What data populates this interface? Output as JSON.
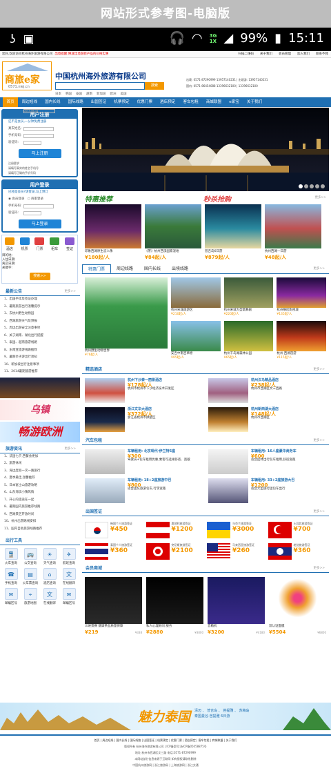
{
  "banner": {
    "title": "网站形式参考图-电脑版"
  },
  "status": {
    "network": "3G\n1X",
    "battery": "99%",
    "time": "15:11"
  },
  "colors": {
    "brand": "#1f6fb2",
    "accent": "#f39800",
    "price": "#f39800"
  },
  "topbar": {
    "welcome": "您好,欢迎访问杭州海外旅游有限公司",
    "notice": "出境提醒:释放出境游新产品的价格实惠",
    "links": [
      "扫描二维码",
      "关于我们",
      "会员管理",
      "加入我们",
      "联系不我"
    ]
  },
  "header": {
    "logo_text": "商旅e家",
    "logo_url": "0571.nlej.cn",
    "company": "中国杭州海外旅游有限公司",
    "search_btn": "搜索",
    "hot_keywords": [
      "日本",
      "韩国",
      "泰国",
      "越南",
      "新加坡",
      "欧洲",
      "美国"
    ],
    "contact_lines": [
      "出境: 0571-87290999  13957140231  | 出境游: 13957140231",
      "国内: 0571-86454088  13396632100  | 13396632100"
    ]
  },
  "nav": {
    "items": [
      "首页",
      "周边短线",
      "国内长线",
      "国际线路",
      "出国签证",
      "机票预定",
      "优惠门票",
      "酒店预定",
      "客车包租",
      "商城联盟",
      "e家宝",
      "关于我们"
    ]
  },
  "register": {
    "title": "用户注册",
    "note": "还不是会员,一分钟免费注册",
    "fields": [
      "真实姓名:",
      "手机号码:",
      "验证码:"
    ],
    "button": "马上注册",
    "tips": [
      "注册要求",
      "请填写真实的姓名手机号",
      "请填写正确的手机号码"
    ]
  },
  "login": {
    "title": "用户登录",
    "note": "已经是会员?请登录,马上预订",
    "options": [
      "会员登录",
      "商家登录"
    ],
    "fields": [
      "手机号码:",
      "验证码:"
    ],
    "button": "马上登录"
  },
  "booking": {
    "tabs": [
      "酒店",
      "机票",
      "门票",
      "租车",
      "签证"
    ],
    "fields": [
      "目的地:",
      "入住日期:",
      "离店日期:",
      "关键字:"
    ],
    "dates": [
      "2015-06-14",
      "2015-06-15"
    ],
    "button": "搜索>>"
  },
  "news": {
    "title": "最新公告",
    "more": "更多>>",
    "items": [
      "1、出国手续及签证办理",
      "2、暑期旅游出行温馨提示",
      "3、去杭州野生动物园",
      "4、西湖旅游天气及预报",
      "5、周边出游安全注意事项",
      "6、关于湖南、湖北出行提醒",
      "7、泰国、越南旅游线路",
      "8、东南亚旅游线路推荐",
      "9、暑期亲子游出行须知",
      "10、新加坡出行注意事项",
      "11、2014暑期旅游推荐"
    ]
  },
  "ads": {
    "wuzhen": "乌镇",
    "europe": "畅游欧洲"
  },
  "tips2": {
    "title": "旅游资讯",
    "more": "更多>>",
    "items": [
      "1、法国七夕,西餐会更加",
      "2、旅游休闲",
      "3、海边度假一次一路旅行",
      "4、夏季最佳,温馨推荐",
      "5、日本富士山旅游攻略",
      "6、山东海滨小镇风情",
      "7、开心的旅途在一起",
      "8、暑期国内旅游推荐线路",
      "9、西湖景区开放时间",
      "10、杭州出游路线安排",
      "11、国内自助旅游线路推荐"
    ]
  },
  "tools": {
    "title": "出行工具",
    "items": [
      "火车查询",
      "公交查询",
      "天气查询",
      "航班查询",
      "手机查询",
      "火车票查询",
      "酒店查询",
      "在线翻译",
      "邮编区号",
      "旅游地图",
      "在线翻译",
      "邮编区号"
    ]
  },
  "promo": {
    "special_title": "特惠推荐",
    "flash_title": "秒杀抢购",
    "more": "更多>>",
    "cards": [
      {
        "name": "印象西湖原生态人像",
        "price": "¥180起/人"
      },
      {
        "name": "《茶》杭州西溪国家湿地",
        "price": "¥84起/人"
      },
      {
        "name": "普吉岛6日游",
        "price": "¥879起/人"
      },
      {
        "name": "杭州西湖一日游",
        "price": "¥48起/人"
      }
    ]
  },
  "routes": {
    "tabs": [
      "特惠门票",
      "周边线路",
      "国内长线",
      "出境线路"
    ],
    "more": "更多>>",
    "items": [
      {
        "name": "杭州野生动物世界",
        "price": "¥76起/人"
      },
      {
        "name": "杭州宋城旅游区",
        "price": "¥210起/人"
      },
      {
        "name": "杭州宋城大型歌舞剧",
        "price": "¥220起/人"
      },
      {
        "name": "杭州横店影视城",
        "price": "¥135起/人"
      },
      {
        "name": "安吉中南百草原",
        "price": "¥95起/人"
      },
      {
        "name": "杭州千岛湖森林公园",
        "price": "¥65起/人"
      },
      {
        "name": "杭州 西湖夜游",
        "price": "¥115起/人"
      }
    ]
  },
  "hotels": {
    "title": "精选酒店",
    "more": "更多>>",
    "items": [
      {
        "name": "杭州下沙泰一丽景酒店",
        "price": "¥178起/人",
        "addr": "杭州市杭州市下沙经济技术开发区"
      },
      {
        "name": "杭州汉马精品酒店",
        "price": "¥238起/人",
        "addr": "杭州市西湖区文三西路"
      },
      {
        "name": "浙江文华大酒店",
        "price": "¥372起/人",
        "addr": "浙江省杭州市拱墅区"
      },
      {
        "name": "杭州新西湖大酒店",
        "price": "¥148起/人",
        "addr": "杭州市西湖区"
      }
    ]
  },
  "buses": {
    "title": "汽车包租",
    "more": "更多>>",
    "items": [
      {
        "name": "车辆租用: 北京现代·伊兰特5座",
        "price": "¥300",
        "desc": "驾驶员+包车租用优惠,乘客可选择舒适、宽敞"
      },
      {
        "name": "车辆租用: 16人座豪华商务车",
        "price": "¥600",
        "desc": "适合团体出行包车租用,舒适宽敞"
      },
      {
        "name": "车辆租用: 18+2座旅游中巴",
        "price": "¥800",
        "desc": "适合团队旅游包车,行李宽敞"
      },
      {
        "name": "车辆租用: 33+2座旅游大巴",
        "price": "¥1200",
        "desc": "适合大型旅行团包车出行"
      }
    ]
  },
  "visas": {
    "title": "出国签证",
    "more": "更多>>",
    "items": [
      {
        "name": "韩国个人旅游签证",
        "price": "¥450"
      },
      {
        "name": "奥地利旅游签证",
        "price": "¥1200"
      },
      {
        "name": "乌克兰旅游签证",
        "price": "¥3000"
      },
      {
        "name": "土耳其旅游签证",
        "price": "¥700"
      },
      {
        "name": "泰国个人旅游签证",
        "price": "¥360"
      },
      {
        "name": "突尼斯旅游签证",
        "price": "¥2100"
      },
      {
        "name": "马来西亚旅游签证",
        "price": "¥260"
      },
      {
        "name": "老挝旅游签证",
        "price": "¥360"
      }
    ]
  },
  "mall": {
    "title": "会员商城",
    "more": "更多>>",
    "items": [
      {
        "name": "三峡景赛 健康茶品质量保障",
        "price": "¥219",
        "old": "¥338"
      },
      {
        "name": "私人心理顾问 服务",
        "price": "¥2880",
        "old": "¥3800"
      },
      {
        "name": "音箱机",
        "price": "¥3200",
        "old": "¥4180"
      },
      {
        "name": "双认证面膜",
        "price": "¥5504",
        "old": "¥6800"
      }
    ]
  },
  "thai": {
    "title": "魅力泰国",
    "lines": [
      "清迈 、 普吉岛 、 芭提雅 、 苏梅岛",
      "泰国曼谷·芭提雅 6日游"
    ]
  },
  "footer": {
    "links": "首页 | 周边短线 | 国内长线 | 国际线路 | 出国签证 | 机票预定 | 优惠门票 | 酒店预定 | 客车包租 | 商城联盟 | 关于我们",
    "lines": [
      "版权所有 杭州海外旅游有限公司 | ICP备案号:浙ICP备05058875号",
      "地址:杭州市西湖区文三路 电话:0571-87290999",
      "本网站部分信息来源于互联网 如有侵权请联系删除",
      "中国杭州旅游网 | 浙江旅游局 | 上海旅游网 | 浙江交通"
    ]
  }
}
